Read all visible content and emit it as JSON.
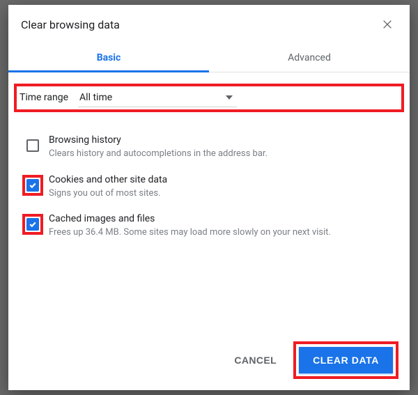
{
  "dialog": {
    "title": "Clear browsing data",
    "tabs": {
      "basic": "Basic",
      "advanced": "Advanced",
      "active": "basic"
    },
    "timeRange": {
      "label": "Time range",
      "value": "All time"
    },
    "options": [
      {
        "key": "history",
        "title": "Browsing history",
        "desc": "Clears history and autocompletions in the address bar.",
        "checked": false,
        "highlight": false
      },
      {
        "key": "cookies",
        "title": "Cookies and other site data",
        "desc": "Signs you out of most sites.",
        "checked": true,
        "highlight": true
      },
      {
        "key": "cache",
        "title": "Cached images and files",
        "desc": "Frees up 36.4 MB. Some sites may load more slowly on your next visit.",
        "checked": true,
        "highlight": true
      }
    ],
    "buttons": {
      "cancel": "CANCEL",
      "clear": "CLEAR DATA"
    }
  }
}
